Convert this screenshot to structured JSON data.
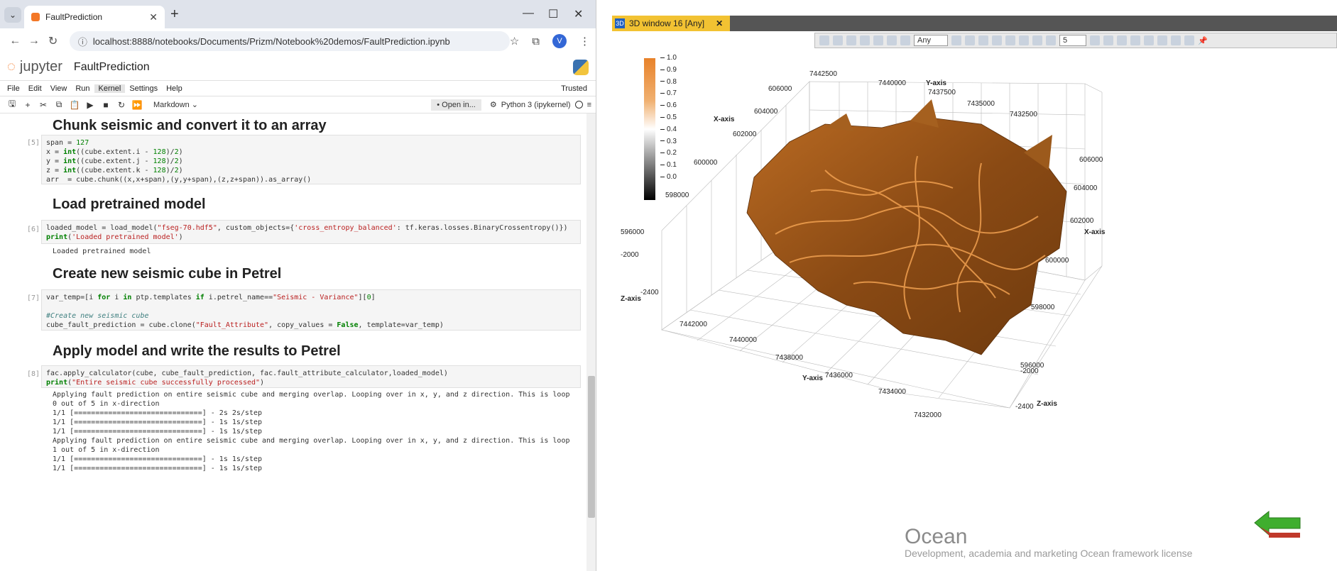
{
  "browser": {
    "tab_title": "FaultPrediction",
    "url": "localhost:8888/notebooks/Documents/Prizm/Notebook%20demos/FaultPrediction.ipynb",
    "avatar_letter": "V"
  },
  "jupyter": {
    "logo_text": "jupyter",
    "notebook_title": "FaultPrediction",
    "menu": [
      "File",
      "Edit",
      "View",
      "Run",
      "Kernel",
      "Settings",
      "Help"
    ],
    "trusted": "Trusted",
    "cell_type": "Markdown",
    "open_in": "Open in...",
    "kernel": "Python 3 (ipykernel)"
  },
  "notebook": {
    "h1": "Chunk seismic and convert it to an array",
    "p5": "[5]:",
    "h2": "Load pretrained model",
    "p6": "[6]:",
    "out6": "Loaded pretrained model",
    "h3": "Create new seismic cube in Petrel",
    "p7": "[7]:",
    "h4": "Apply model and write the results to Petrel",
    "p8": "[8]:",
    "out8_l1": "Applying fault prediction on entire seismic cube and merging overlap. Looping over in x, y, and z direction. This is loop",
    "out8_l2": "0 out of 5 in x-direction",
    "out8_l3": "1/1 [==============================] - 2s 2s/step",
    "out8_l4": "1/1 [==============================] - 1s 1s/step",
    "out8_l5": "1/1 [==============================] - 1s 1s/step",
    "out8_l6": "Applying fault prediction on entire seismic cube and merging overlap. Looping over in x, y, and z direction. This is loop",
    "out8_l7": "1 out of 5 in x-direction",
    "out8_l8": "1/1 [==============================] - 1s 1s/step",
    "out8_l9": "1/1 [==============================] - 1s 1s/step"
  },
  "petrel": {
    "window_title": "3D window 16 [Any]",
    "toolbar_any": "Any",
    "toolbar_num": "5",
    "colorbar_ticks": [
      "1.0",
      "0.9",
      "0.8",
      "0.7",
      "0.6",
      "0.5",
      "0.4",
      "0.3",
      "0.2",
      "0.1",
      "0.0"
    ],
    "ocean": "Ocean",
    "ocean_sub": "Development, academia and marketing Ocean framework license",
    "axis_names": {
      "x": "X-axis",
      "y": "Y-axis",
      "z": "Z-axis"
    },
    "top_y_ticks": [
      "7442500",
      "7440000",
      "7437500",
      "7435000",
      "7432500"
    ],
    "left_x_ticks": [
      "606000",
      "604000",
      "602000",
      "600000",
      "598000",
      "596000"
    ],
    "left_z_ticks": [
      "-2000",
      "-2400"
    ],
    "bottom_y_ticks": [
      "7442000",
      "7440000",
      "7438000",
      "7436000",
      "7434000",
      "7432000"
    ],
    "right_x_ticks": [
      "606000",
      "604000",
      "602000",
      "600000",
      "598000",
      "596000"
    ],
    "right_z_ticks": [
      "-2000",
      "-2400"
    ]
  }
}
